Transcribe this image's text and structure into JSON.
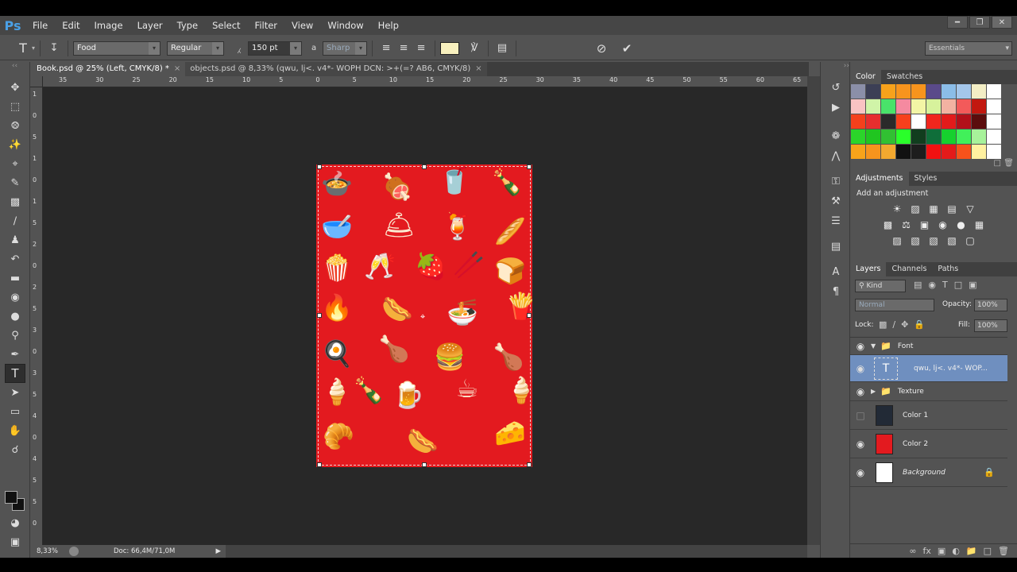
{
  "app": {
    "logo": "Ps"
  },
  "menu": [
    "File",
    "Edit",
    "Image",
    "Layer",
    "Type",
    "Select",
    "Filter",
    "View",
    "Window",
    "Help"
  ],
  "options": {
    "font_family": "Food",
    "font_style": "Regular",
    "font_size": "150 pt",
    "antialias": "Sharp",
    "workspace": "Essentials"
  },
  "tabs": [
    {
      "label": "Book.psd @ 25% (Left, CMYK/8) *",
      "close": "×"
    },
    {
      "label": "objects.psd @ 8,33% (qwu, lj<. v4*- WOPH DCN: >+(=? AB6, CMYK/8)",
      "close": "×"
    }
  ],
  "ruler_h": [
    "35",
    "30",
    "25",
    "20",
    "15",
    "10",
    "5",
    "0",
    "5",
    "10",
    "15",
    "20",
    "25",
    "30",
    "35",
    "40",
    "45",
    "50",
    "55",
    "60",
    "65"
  ],
  "ruler_v": [
    "1",
    "0",
    "5",
    "1",
    "0",
    "1",
    "5",
    "2",
    "0",
    "2",
    "5",
    "3",
    "0",
    "3",
    "5",
    "4",
    "0",
    "4",
    "5",
    "5",
    "0"
  ],
  "status": {
    "zoom": "8,33%",
    "doc": "Doc: 66,4M/71,0M"
  },
  "color_panel": {
    "tabs": [
      "Color",
      "Swatches"
    ]
  },
  "swatches": [
    "#8b8fa8",
    "#3c3f55",
    "#f7a21b",
    "#f7941d",
    "#f7941d",
    "#5a4a8a",
    "#8bbde8",
    "#a4c6ea",
    "#f3eec5",
    "#ffffff",
    "#f9c3c3",
    "#d0f4a8",
    "#49e36a",
    "#f58aa0",
    "#f3f5a5",
    "#d7f29c",
    "#f2b2a2",
    "#f35a5a",
    "#c2180f",
    "#ffffff",
    "#f5401c",
    "#e62e2e",
    "#2a2a2a",
    "#f7401c",
    "#ffffff",
    "#f0261d",
    "#e21b1b",
    "#b2101a",
    "#5b0d0d",
    "#ffffff",
    "#2bd52a",
    "#20c520",
    "#31c032",
    "#2aff2a",
    "#113d1e",
    "#0f6e3a",
    "#16d12e",
    "#41f05a",
    "#a7f29a",
    "#ffffff",
    "#f8a31a",
    "#f7941d",
    "#f2a82f",
    "#111111",
    "#1d1d1d",
    "#f21111",
    "#e41a1a",
    "#f7521b",
    "#fff1a0",
    "#ffffff"
  ],
  "adjustments": {
    "tabs": [
      "Adjustments",
      "Styles"
    ],
    "title": "Add an adjustment"
  },
  "layers_panel": {
    "tabs": [
      "Layers",
      "Channels",
      "Paths"
    ],
    "kind": "Kind",
    "blend": "Normal",
    "opacity_label": "Opacity:",
    "opacity": "100%",
    "lock_label": "Lock:",
    "fill_label": "Fill:",
    "fill": "100%",
    "layers": [
      {
        "name": "Font",
        "type": "group"
      },
      {
        "name": "qwu, lj<. v4*- WOP...",
        "type": "text"
      },
      {
        "name": "Texture",
        "type": "group"
      },
      {
        "name": "Color 1",
        "type": "fill"
      },
      {
        "name": "Color 2",
        "type": "fill"
      },
      {
        "name": "Background",
        "type": "bg"
      }
    ]
  },
  "colors": {
    "accent": "#e31a1f",
    "selected_layer": "#6f8fbf",
    "canvas_bg": "#282828"
  }
}
